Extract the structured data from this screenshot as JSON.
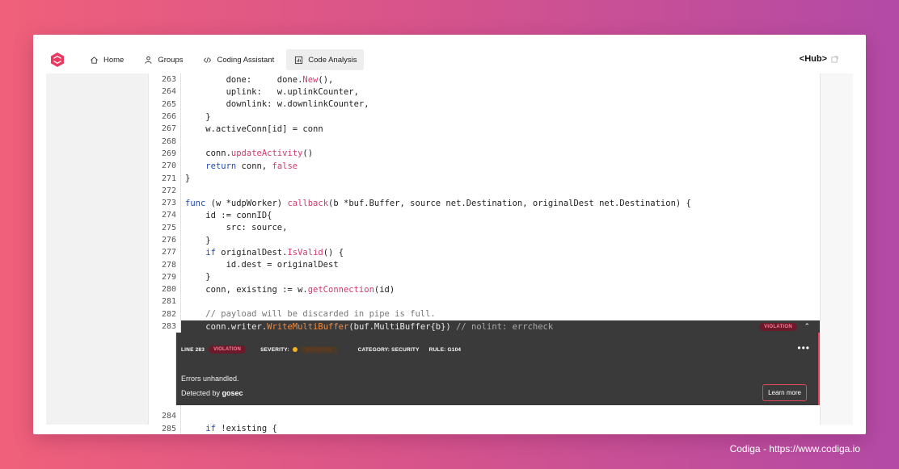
{
  "nav": {
    "items": [
      {
        "label": "Home",
        "icon": "home-icon"
      },
      {
        "label": "Groups",
        "icon": "groups-icon"
      },
      {
        "label": "Coding Assistant",
        "icon": "code-icon"
      },
      {
        "label": "Code Analysis",
        "icon": "analysis-icon",
        "active": true
      }
    ],
    "hub_label": "<Hub>"
  },
  "code_lines": [
    {
      "n": "263",
      "segments": [
        [
          "        done:     done.",
          ""
        ],
        [
          "New",
          "fn"
        ],
        [
          "(),",
          ""
        ]
      ]
    },
    {
      "n": "264",
      "segments": [
        [
          "        uplink:   w.uplinkCounter,",
          ""
        ]
      ]
    },
    {
      "n": "265",
      "segments": [
        [
          "        downlink: w.downlinkCounter,",
          ""
        ]
      ]
    },
    {
      "n": "266",
      "segments": [
        [
          "    }",
          ""
        ]
      ]
    },
    {
      "n": "267",
      "segments": [
        [
          "    w.activeConn[id] = conn",
          ""
        ]
      ]
    },
    {
      "n": "268",
      "segments": [
        [
          "",
          ""
        ]
      ]
    },
    {
      "n": "269",
      "segments": [
        [
          "    conn.",
          ""
        ],
        [
          "updateActivity",
          "fn"
        ],
        [
          "()",
          ""
        ]
      ]
    },
    {
      "n": "270",
      "segments": [
        [
          "    ",
          ""
        ],
        [
          "return",
          "kw"
        ],
        [
          " conn, ",
          ""
        ],
        [
          "false",
          "fl"
        ]
      ]
    },
    {
      "n": "271",
      "segments": [
        [
          "}",
          ""
        ]
      ]
    },
    {
      "n": "272",
      "segments": [
        [
          "",
          ""
        ]
      ]
    },
    {
      "n": "273",
      "segments": [
        [
          "func",
          "kw"
        ],
        [
          " (w *udpWorker) ",
          ""
        ],
        [
          "callback",
          "fn"
        ],
        [
          "(b *buf.Buffer, source net.Destination, originalDest net.Destination) {",
          ""
        ]
      ]
    },
    {
      "n": "274",
      "segments": [
        [
          "    id := connID{",
          ""
        ]
      ]
    },
    {
      "n": "275",
      "segments": [
        [
          "        src: source,",
          ""
        ]
      ]
    },
    {
      "n": "276",
      "segments": [
        [
          "    }",
          ""
        ]
      ]
    },
    {
      "n": "277",
      "segments": [
        [
          "    ",
          ""
        ],
        [
          "if",
          "kw"
        ],
        [
          " originalDest.",
          ""
        ],
        [
          "IsValid",
          "fn"
        ],
        [
          "() {",
          ""
        ]
      ]
    },
    {
      "n": "278",
      "segments": [
        [
          "        id.dest = originalDest",
          ""
        ]
      ]
    },
    {
      "n": "279",
      "segments": [
        [
          "    }",
          ""
        ]
      ]
    },
    {
      "n": "280",
      "segments": [
        [
          "    conn, existing := w.",
          ""
        ],
        [
          "getConnection",
          "fn"
        ],
        [
          "(id)",
          ""
        ]
      ]
    },
    {
      "n": "281",
      "segments": [
        [
          "",
          ""
        ]
      ]
    },
    {
      "n": "282",
      "segments": [
        [
          "    // payload will be discarded in pipe is full.",
          "cm"
        ]
      ]
    }
  ],
  "violation_line": {
    "n": "283",
    "segments": [
      [
        "    conn.writer.",
        ""
      ],
      [
        "WriteMultiBuffer",
        "fn"
      ],
      [
        "(buf.MultiBuffer{b}) ",
        ""
      ],
      [
        "// nolint: errcheck",
        "cm"
      ]
    ],
    "tag": "VIOLATION"
  },
  "violation_panel": {
    "line_label": "LINE 283",
    "tag": "VIOLATION",
    "severity_label": "SEVERITY:",
    "severity_value": "WARNING",
    "category": "CATEGORY: SECURITY",
    "rule": "RULE: G104",
    "message": "Errors unhandled.",
    "detected_prefix": "Detected by",
    "detector": "gosec",
    "learn_more": "Learn more",
    "colors": {
      "accent": "#e0485f",
      "severity_dot": "#f2b51c"
    }
  },
  "code_lines_after": [
    {
      "n": "284",
      "segments": [
        [
          "",
          ""
        ]
      ]
    },
    {
      "n": "285",
      "segments": [
        [
          "    ",
          ""
        ],
        [
          "if",
          "kw"
        ],
        [
          " !existing {",
          ""
        ]
      ]
    }
  ],
  "credit": "Codiga - https://www.codiga.io"
}
